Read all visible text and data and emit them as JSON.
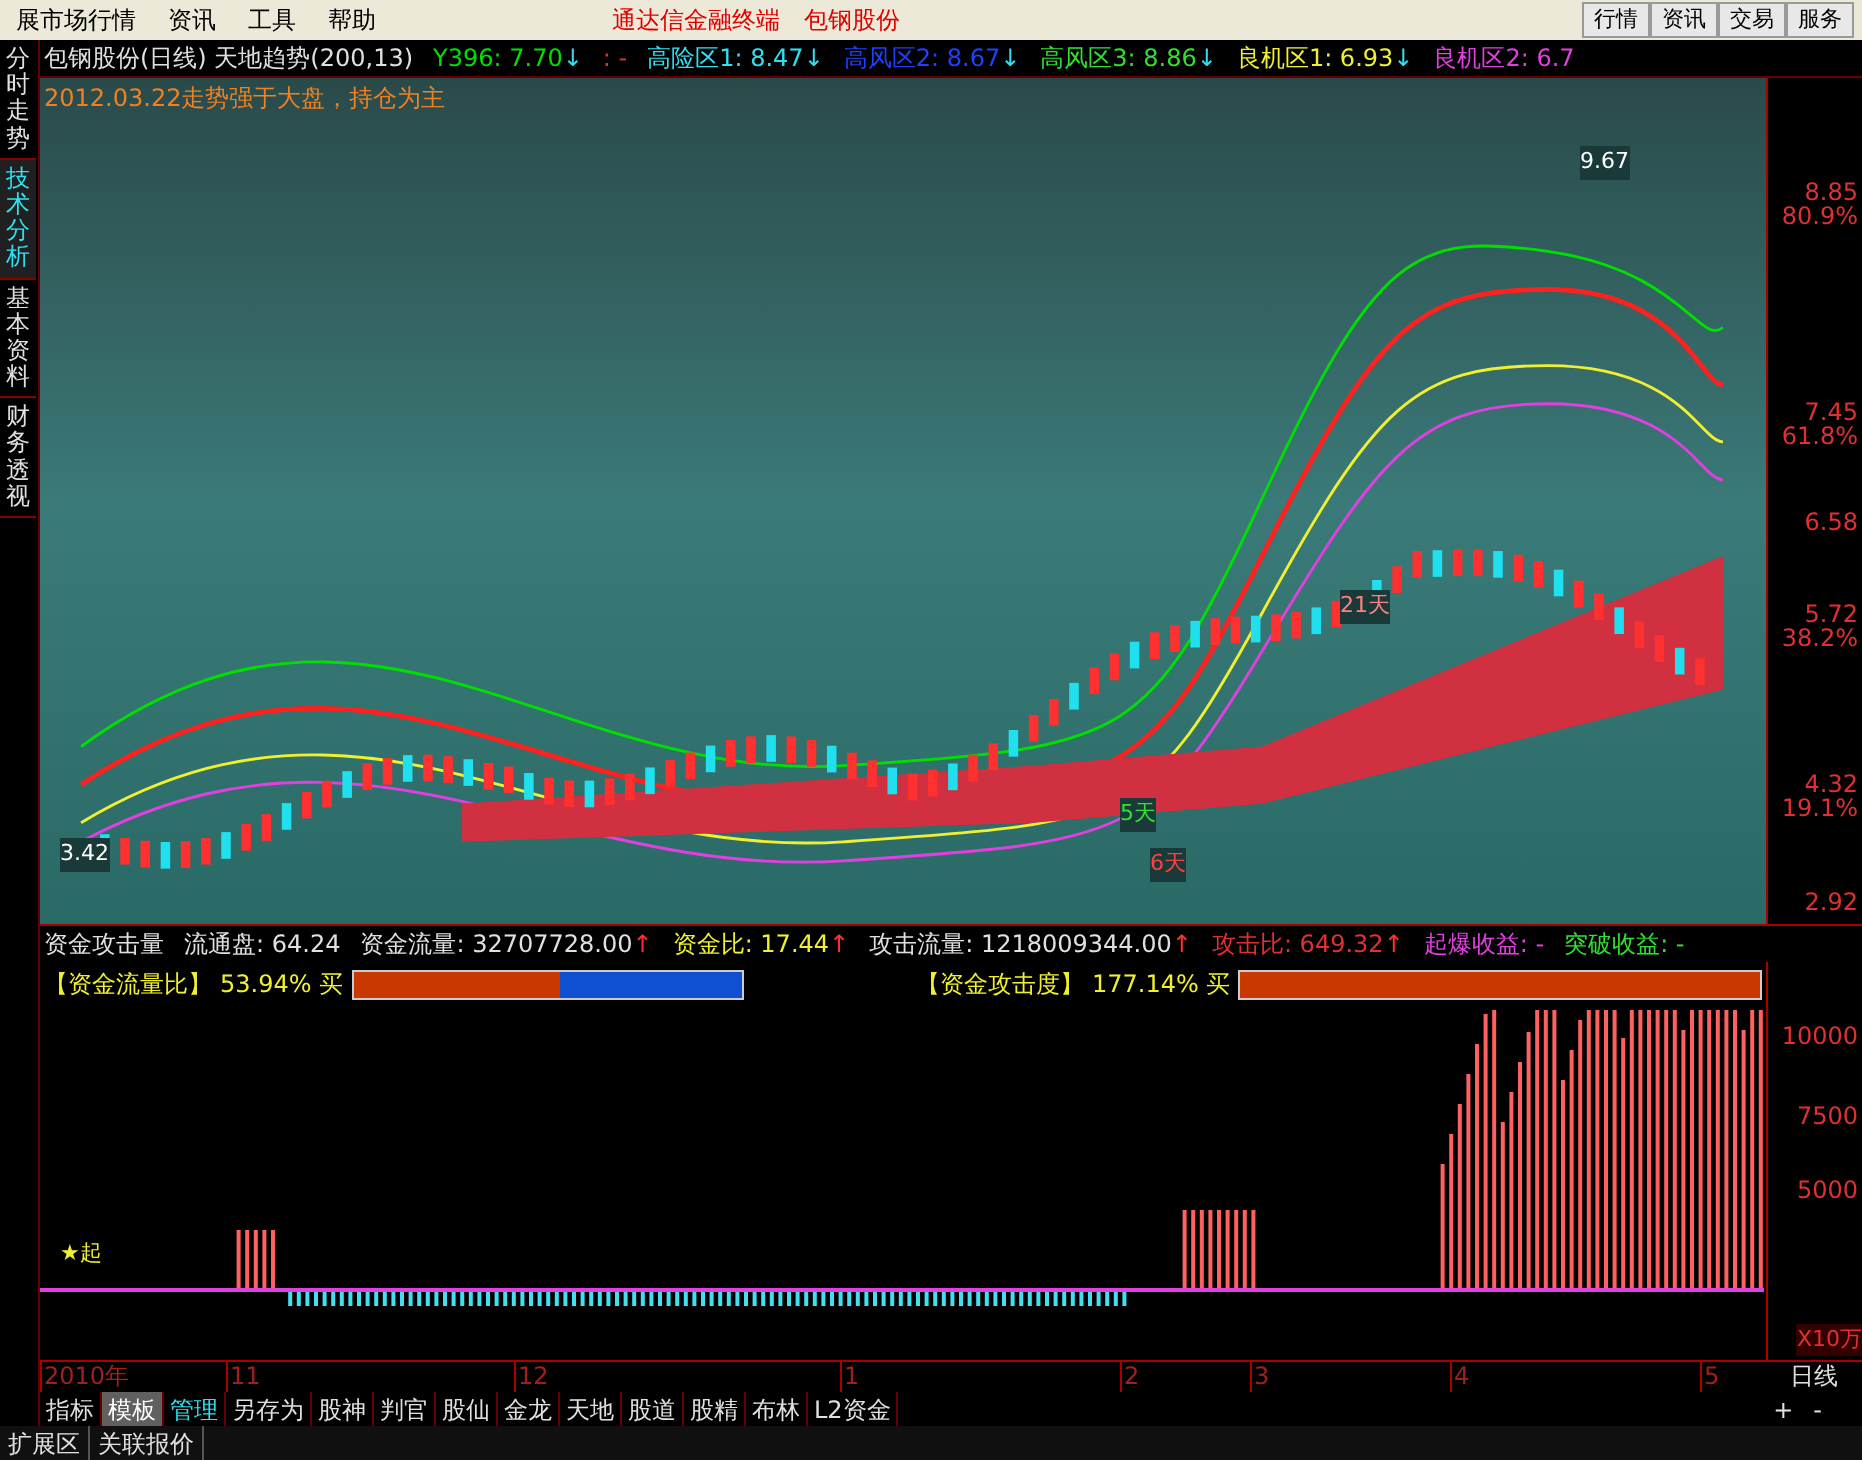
{
  "menu_bar": {
    "items": [
      "展市场行情",
      "资讯",
      "工具",
      "帮助"
    ],
    "app_title": "通达信金融终端",
    "stock": "包钢股份",
    "buttons": [
      "行情",
      "资讯",
      "交易",
      "服务"
    ]
  },
  "side_tabs": [
    {
      "label": "分时走势",
      "selected": false
    },
    {
      "label": "技术分析",
      "selected": true
    },
    {
      "label": "基本资料",
      "selected": false
    },
    {
      "label": "财务透视",
      "selected": false
    }
  ],
  "price_panel": {
    "title": "包钢股份(日线) 天地趋势(200,13)",
    "indicators": [
      {
        "label": "Y396: 7.70",
        "arrow": "↓"
      },
      {
        "label": ": -"
      },
      {
        "label": "高险区1: 8.47",
        "arrow": "↓"
      },
      {
        "label": "高风区2: 8.67",
        "arrow": "↓"
      },
      {
        "label": "高风区3: 8.86",
        "arrow": "↓"
      },
      {
        "label": "良机区1: 6.93",
        "arrow": "↓"
      },
      {
        "label": "良机区2: 6.7"
      }
    ],
    "signal": "2012.03.22走势强于大盘，持仓为主",
    "annotations": [
      "3.42",
      "9.67",
      "21天",
      "5天",
      "6天"
    ],
    "y_axis": [
      {
        "value": "8.85",
        "pct": "80.9%"
      },
      {
        "value": "7.45",
        "pct": "61.8%"
      },
      {
        "value": "6.58"
      },
      {
        "value": "5.72",
        "pct": "38.2%"
      },
      {
        "value": "4.32",
        "pct": "19.1%"
      },
      {
        "value": "2.92"
      }
    ]
  },
  "flow_panel": {
    "name": "资金攻击量",
    "stats": [
      {
        "label": "流通盘: 64.24"
      },
      {
        "label": "资金流量: 32707728.00",
        "arrow": "↑"
      },
      {
        "label": "资金比: 17.44",
        "arrow": "↑"
      },
      {
        "label": "攻击流量: 1218009344.00",
        "arrow": "↑"
      },
      {
        "label": "攻击比: 649.32",
        "arrow": "↑"
      },
      {
        "label": "起爆收益: -"
      },
      {
        "label": "突破收益: -"
      }
    ],
    "gauges": [
      {
        "label": "【资金流量比】",
        "reading": "53.94% 买",
        "level": 0.53
      },
      {
        "label": "【资金攻击度】",
        "reading": "177.14% 买",
        "level": 1
      }
    ],
    "start_label": "★起",
    "y_axis": [
      "10000",
      "7500",
      "5000"
    ],
    "unit": "X10万"
  },
  "date_axis": {
    "labels": [
      "2010年",
      "11",
      "12",
      "1",
      "2",
      "3",
      "4",
      "5"
    ],
    "period": "日线"
  },
  "template_tabs": [
    {
      "label": "指标",
      "selected": false
    },
    {
      "label": "模板",
      "selected": true
    },
    {
      "label": "管理",
      "selected": false
    },
    {
      "label": "另存为",
      "selected": false
    },
    {
      "label": "股神",
      "selected": false
    },
    {
      "label": "判官",
      "selected": false
    },
    {
      "label": "股仙",
      "selected": false
    },
    {
      "label": "金龙",
      "selected": false
    },
    {
      "label": "天地",
      "selected": false
    },
    {
      "label": "股道",
      "selected": false
    },
    {
      "label": "股精",
      "selected": false
    },
    {
      "label": "布林",
      "selected": false
    },
    {
      "label": "L2资金",
      "selected": false
    }
  ],
  "zoom_controls": [
    "+",
    "-"
  ],
  "bottom_tabs": [
    "扩展区",
    "关联报价"
  ]
}
